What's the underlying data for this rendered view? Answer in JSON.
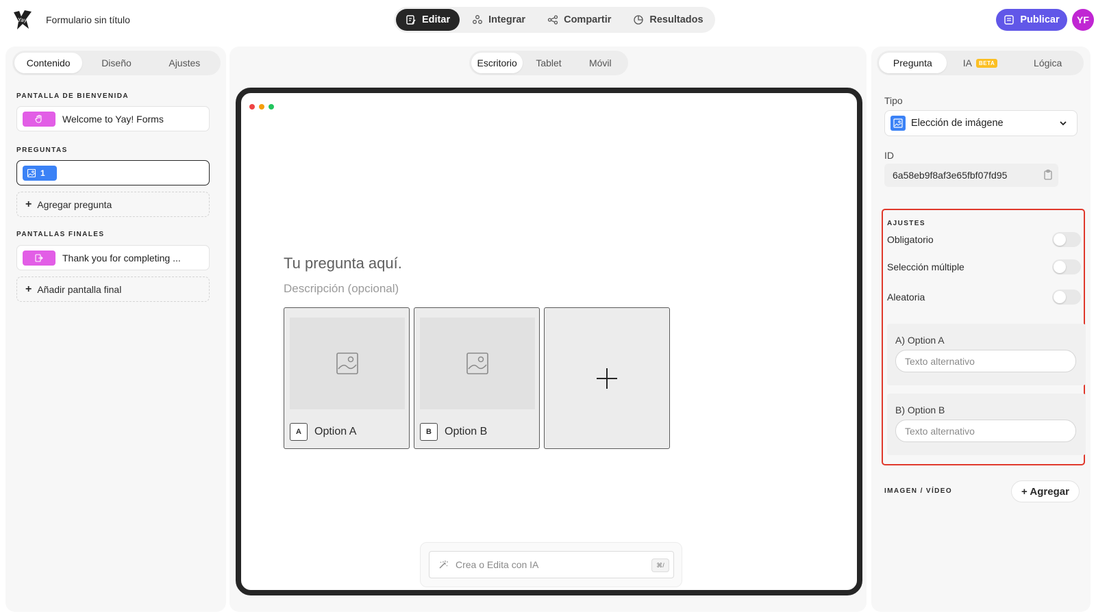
{
  "header": {
    "form_title": "Formulario sin título",
    "modes": [
      {
        "label": "Editar",
        "icon": "edit-icon",
        "active": true
      },
      {
        "label": "Integrar",
        "icon": "integrate-icon",
        "active": false
      },
      {
        "label": "Compartir",
        "icon": "share-icon",
        "active": false
      },
      {
        "label": "Resultados",
        "icon": "results-icon",
        "active": false
      }
    ],
    "publish_label": "Publicar",
    "avatar_initials": "YF",
    "accent_color": "#6157e8"
  },
  "left": {
    "tabs": [
      "Contenido",
      "Diseño",
      "Ajustes"
    ],
    "welcome_title": "PANTALLA DE BIENVENIDA",
    "welcome_item": "Welcome to Yay! Forms",
    "questions_title": "PREGUNTAS",
    "question_number": "1",
    "add_question": "Agregar pregunta",
    "endings_title": "PANTALLAS FINALES",
    "ending_item": "Thank you for completing ...",
    "add_ending": "Añadir pantalla final"
  },
  "center": {
    "devices": [
      "Escritorio",
      "Tablet",
      "Móvil"
    ],
    "question_title": "Tu pregunta aquí.",
    "question_desc": "Descripción (opcional)",
    "options": [
      {
        "key": "A",
        "label": "Option A"
      },
      {
        "key": "B",
        "label": "Option B"
      }
    ],
    "ai_placeholder": "Crea o Edita con IA",
    "ai_shortcut": "⌘/"
  },
  "right": {
    "tabs": [
      "Pregunta",
      "IA",
      "Lógica"
    ],
    "beta_badge": "BETA",
    "type_label": "Tipo",
    "type_value": "Elección de imágene",
    "id_label": "ID",
    "id_value": "6a58eb9f8af3e65fbf07fd95",
    "settings_title": "AJUSTES",
    "toggles": [
      "Obligatorio",
      "Selección múltiple",
      "Aleatoria"
    ],
    "alt_blocks": [
      {
        "title": "A) Option A",
        "placeholder": "Texto alternativo"
      },
      {
        "title": "B) Option B",
        "placeholder": "Texto alternativo"
      }
    ],
    "media_title": "IMAGEN / VÍDEO",
    "media_add": "+ Agregar"
  }
}
